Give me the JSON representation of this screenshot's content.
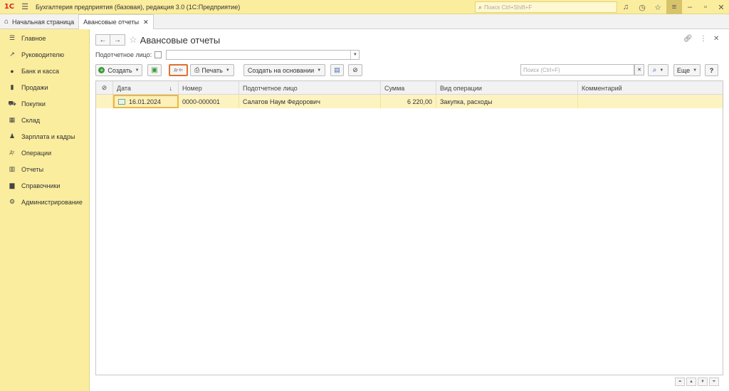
{
  "topbar": {
    "logo": "1С",
    "title": "Бухгалтерия предприятия (базовая), редакция 3.0  (1С:Предприятие)",
    "search_placeholder": "Поиск Ctrl+Shift+F"
  },
  "tabs": {
    "home": "Начальная страница",
    "active": "Авансовые отчеты"
  },
  "sidebar": {
    "items": [
      {
        "label": "Главное",
        "icon": "menu-icon"
      },
      {
        "label": "Руководителю",
        "icon": "trend-icon"
      },
      {
        "label": "Банк и касса",
        "icon": "coin-icon"
      },
      {
        "label": "Продажи",
        "icon": "bag-icon"
      },
      {
        "label": "Покупки",
        "icon": "cart-icon"
      },
      {
        "label": "Склад",
        "icon": "warehouse-icon"
      },
      {
        "label": "Зарплата и кадры",
        "icon": "person-icon"
      },
      {
        "label": "Операции",
        "icon": "dt-kt-icon"
      },
      {
        "label": "Отчеты",
        "icon": "bar-chart-icon"
      },
      {
        "label": "Справочники",
        "icon": "book-icon"
      },
      {
        "label": "Администрирование",
        "icon": "gear-icon"
      }
    ]
  },
  "page": {
    "title": "Авансовые отчеты",
    "filter_label": "Подотчетное лицо:"
  },
  "toolbar": {
    "create_label": "Создать",
    "print_label": "Печать",
    "create_based_label": "Создать на основании",
    "search_placeholder": "Поиск (Ctrl+F)",
    "more_label": "Еще",
    "help_label": "?",
    "dtkt_label": "Дт Кт"
  },
  "table": {
    "columns": [
      "Дата",
      "Номер",
      "Подотчетное лицо",
      "Сумма",
      "Вид операции",
      "Комментарий"
    ],
    "rows": [
      {
        "date": "16.01.2024",
        "number": "0000-000001",
        "person": "Салатов Наум Федорович",
        "sum": "6 220,00",
        "operation": "Закупка, расходы",
        "comment": ""
      }
    ]
  }
}
